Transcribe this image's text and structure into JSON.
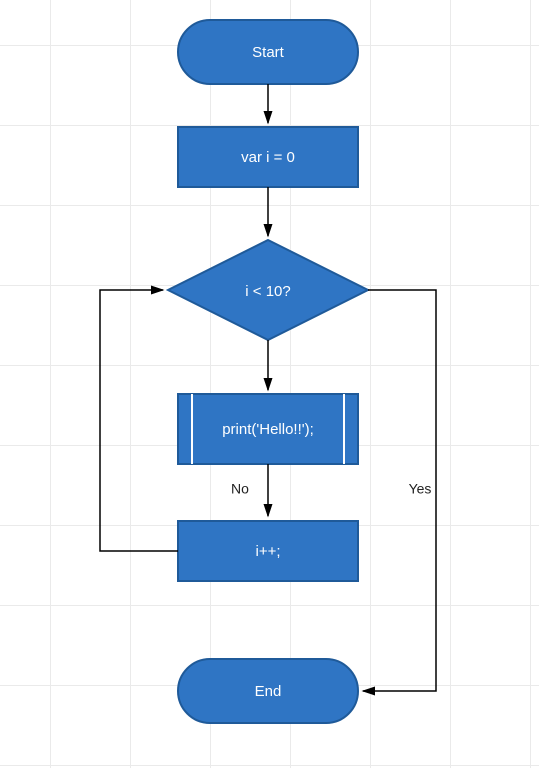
{
  "flowchart": {
    "nodes": {
      "start": {
        "label": "Start",
        "type": "terminator"
      },
      "init": {
        "label": "var i = 0",
        "type": "process"
      },
      "cond": {
        "label": "i < 10?",
        "type": "decision"
      },
      "print": {
        "label": "print('Hello!!');",
        "type": "subroutine"
      },
      "inc": {
        "label": "i++;",
        "type": "process"
      },
      "end": {
        "label": "End",
        "type": "terminator"
      }
    },
    "edges": {
      "no": {
        "label": "No"
      },
      "yes": {
        "label": "Yes"
      }
    },
    "colors": {
      "fill": "#2f75c4",
      "stroke": "#1f5a99",
      "line": "#000000"
    }
  }
}
